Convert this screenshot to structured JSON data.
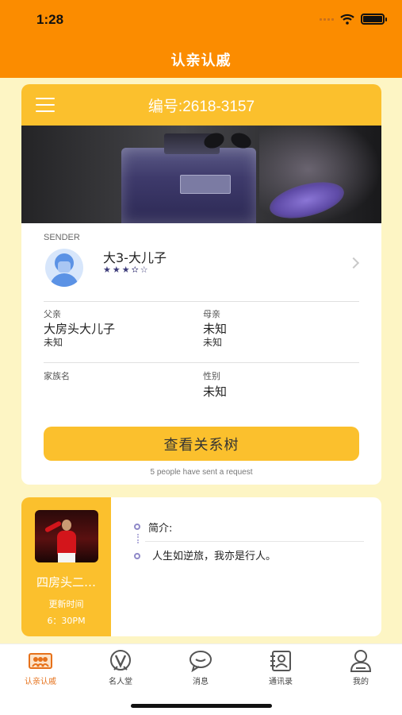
{
  "status_bar": {
    "time": "1:28"
  },
  "nav": {
    "title": "认亲认戚"
  },
  "card": {
    "number_text": "编号:2618-3157",
    "sender": {
      "label": "SENDER",
      "name": "大3-大儿子",
      "rating_text": "★★★✫☆"
    },
    "father": {
      "label": "父亲",
      "name": "大房头大儿子",
      "sub": "未知"
    },
    "mother": {
      "label": "母亲",
      "name": "未知",
      "sub": "未知"
    },
    "family_name": {
      "label": "家族名",
      "value": ""
    },
    "gender": {
      "label": "性别",
      "value": "未知"
    },
    "tree_button": "查看关系树",
    "request_note": "5 people have sent a request"
  },
  "profile_card": {
    "name": "四房头二…",
    "update_label": "更新时间",
    "update_time": "6：30PM",
    "intro_label": "简介:",
    "intro_text": "人生如逆旅，我亦是行人。"
  },
  "tabbar": {
    "items": [
      {
        "label": "认亲认戚",
        "icon": "family-photo-icon",
        "active": true
      },
      {
        "label": "名人堂",
        "icon": "v-badge-icon",
        "active": false
      },
      {
        "label": "消息",
        "icon": "chat-bubble-icon",
        "active": false
      },
      {
        "label": "通讯录",
        "icon": "contacts-book-icon",
        "active": false
      },
      {
        "label": "我的",
        "icon": "user-icon",
        "active": false
      }
    ]
  },
  "colors": {
    "header": "#fb8c00",
    "accent": "#fbc02d",
    "background": "#fdf5c4",
    "active_tab": "#e6711a"
  }
}
